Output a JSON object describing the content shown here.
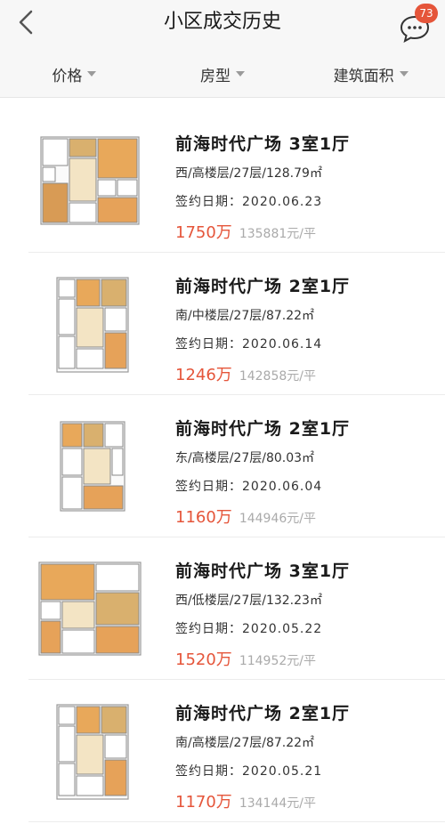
{
  "header": {
    "title": "小区成交历史",
    "message_badge": "73"
  },
  "filters": [
    {
      "label": "价格"
    },
    {
      "label": "房型"
    },
    {
      "label": "建筑面积"
    }
  ],
  "listings": [
    {
      "name": "前海时代广场 3室1厅",
      "desc": "西/高楼层/27层/128.79㎡",
      "date": "签约日期：2020.06.23",
      "price": "1750万",
      "unit_price": "135881元/平"
    },
    {
      "name": "前海时代广场 2室1厅",
      "desc": "南/中楼层/27层/87.22㎡",
      "date": "签约日期：2020.06.14",
      "price": "1246万",
      "unit_price": "142858元/平"
    },
    {
      "name": "前海时代广场 2室1厅",
      "desc": "东/高楼层/27层/80.03㎡",
      "date": "签约日期：2020.06.04",
      "price": "1160万",
      "unit_price": "144946元/平"
    },
    {
      "name": "前海时代广场 3室1厅",
      "desc": "西/低楼层/27层/132.23㎡",
      "date": "签约日期：2020.05.22",
      "price": "1520万",
      "unit_price": "114952元/平"
    },
    {
      "name": "前海时代广场 2室1厅",
      "desc": "南/高楼层/27层/87.22㎡",
      "date": "签约日期：2020.05.21",
      "price": "1170万",
      "unit_price": "134144元/平"
    }
  ]
}
